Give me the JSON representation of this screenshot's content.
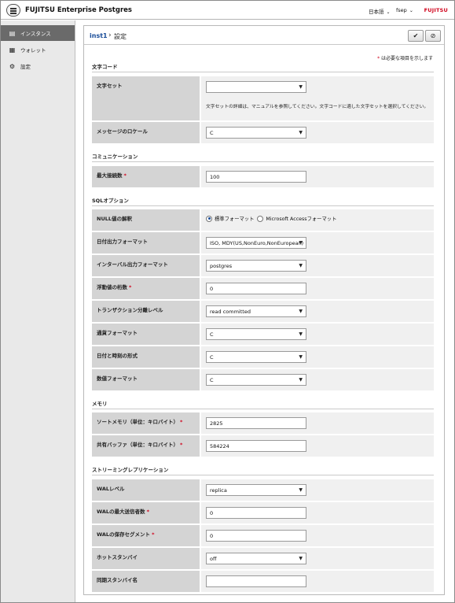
{
  "header": {
    "app_title": "FUJITSU Enterprise Postgres",
    "language": "日本語",
    "user": "fsep",
    "logo": "FUJITSU"
  },
  "sidebar": {
    "items": [
      {
        "label": "インスタンス",
        "icon": "database-icon"
      },
      {
        "label": "ウォレット",
        "icon": "file-icon"
      },
      {
        "label": "設定",
        "icon": "gear-icon"
      }
    ]
  },
  "breadcrumb": {
    "link": "inst1",
    "separator": "›",
    "current": "設定"
  },
  "actions": {
    "save": "✔",
    "cancel": "⊘"
  },
  "required_note": {
    "star": "*",
    "text": "は必要な項目を示します"
  },
  "sections": {
    "charcode": "文字コード",
    "comm": "コミュニケーション",
    "sql": "SQLオプション",
    "mem": "メモリ",
    "repl": "ストリーミングレプリケーション"
  },
  "fields": {
    "charset": {
      "label": "文字セット",
      "value": "",
      "help": "文字セットの詳細は、マニュアルを参照してください。文字コードに適した文字セットを選択してください。"
    },
    "msg_locale": {
      "label": "メッセージのロケール",
      "value": "C"
    },
    "max_conn": {
      "label": "最大接続数",
      "required": "*",
      "value": "100"
    },
    "null_interp": {
      "label": "NULL値の解釈",
      "opt1": "標準フォーマット",
      "opt2": "Microsoft Accessフォーマット",
      "selected": "opt1"
    },
    "date_format": {
      "label": "日付出力フォーマット",
      "value": "ISO, MDY(US,NonEuro,NonEuropean)"
    },
    "interval_format": {
      "label": "インターバル出力フォーマット",
      "value": "postgres"
    },
    "float_digits": {
      "label": "浮動値の桁数",
      "required": "*",
      "value": "0"
    },
    "txn_isolation": {
      "label": "トランザクション分離レベル",
      "value": "read committed"
    },
    "currency": {
      "label": "通貨フォーマット",
      "value": "C"
    },
    "datetime": {
      "label": "日付と時刻の形式",
      "value": "C"
    },
    "numeric": {
      "label": "数値フォーマット",
      "value": "C"
    },
    "sort_mem": {
      "label": "ソートメモリ（単位：キロバイト）",
      "required": "*",
      "value": "2825"
    },
    "shared_buf": {
      "label": "共有バッファ（単位：キロバイト）",
      "required": "*",
      "value": "584224"
    },
    "wal_level": {
      "label": "WALレベル",
      "value": "replica"
    },
    "wal_senders": {
      "label": "WALの最大送信者数",
      "required": "*",
      "value": "0"
    },
    "wal_keep": {
      "label": "WALの保存セグメント",
      "required": "*",
      "value": "0"
    },
    "hot_standby": {
      "label": "ホットスタンバイ",
      "value": "off"
    },
    "sync_standby": {
      "label": "同期スタンバイ名",
      "value": ""
    }
  },
  "colors": {
    "accent": "#1a4d99",
    "required": "#d0021b",
    "sidebar_active": "#6a6a6a"
  }
}
